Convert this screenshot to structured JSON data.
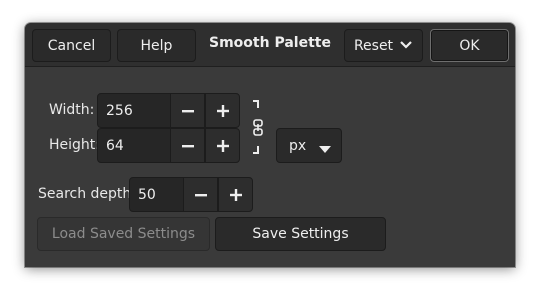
{
  "dialog": {
    "title": "Smooth Palette",
    "cancel_label": "Cancel",
    "help_label": "Help",
    "reset_label": "Reset",
    "ok_label": "OK"
  },
  "size": {
    "width_label": "Width:",
    "width_value": "256",
    "height_label": "Height:",
    "height_value": "64",
    "unit_value": "px",
    "chain_icon": "chain-link-icon"
  },
  "search": {
    "label": "Search depth",
    "value": "50"
  },
  "actions": {
    "load_label": "Load Saved Settings",
    "save_label": "Save Settings"
  },
  "colors": {
    "dialog_bg": "#3a3a3a",
    "header_bg": "#2f2f2f",
    "button_bg": "#2a2a2a",
    "text": "#eeeeee",
    "disabled_text": "#8c8c8c"
  }
}
